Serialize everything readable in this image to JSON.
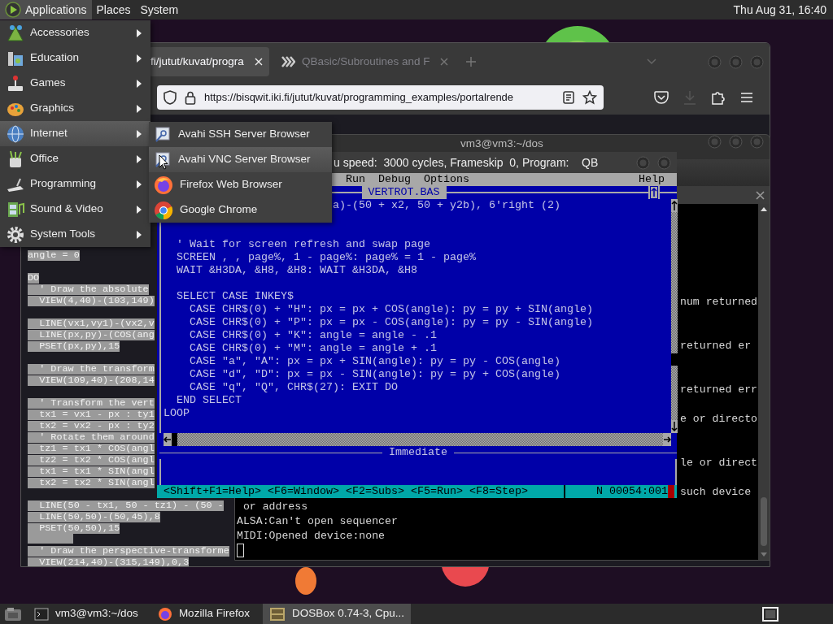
{
  "top_panel": {
    "menus": [
      {
        "label": "Applications",
        "selected": true
      },
      {
        "label": "Places",
        "selected": false
      },
      {
        "label": "System",
        "selected": false
      }
    ],
    "clock": "Thu Aug 31, 16:40"
  },
  "applications_menu": {
    "items": [
      {
        "label": "Accessories",
        "selected": false
      },
      {
        "label": "Education",
        "selected": false
      },
      {
        "label": "Games",
        "selected": false
      },
      {
        "label": "Graphics",
        "selected": false
      },
      {
        "label": "Internet",
        "selected": true
      },
      {
        "label": "Office",
        "selected": false
      },
      {
        "label": "Programming",
        "selected": false
      },
      {
        "label": "Sound & Video",
        "selected": false
      },
      {
        "label": "System Tools",
        "selected": false
      }
    ]
  },
  "internet_submenu": {
    "items": [
      {
        "label": "Avahi SSH Server Browser",
        "selected": false
      },
      {
        "label": "Avahi VNC Server Browser",
        "selected": true
      },
      {
        "label": "Firefox Web Browser",
        "selected": false
      },
      {
        "label": "Google Chrome",
        "selected": false
      }
    ]
  },
  "firefox": {
    "tabs": [
      {
        "title": "fi/jutut/kuvat/progra",
        "selected": true
      },
      {
        "title": "QBasic/Subroutines and F",
        "selected": false
      }
    ],
    "url": "https://bisqwit.iki.fi/jutut/kuvat/programming_examples/portalrende",
    "page_code_lines": [
      {
        "text": "angle = 0"
      },
      {
        "kind": "blank"
      },
      {
        "text": "DO"
      },
      {
        "text": "  ' Draw the absolute"
      },
      {
        "text": "  VIEW(4,40)-(103,149)"
      },
      {
        "kind": "blank"
      },
      {
        "text": "  LINE(vx1,vy1)-(vx2,v"
      },
      {
        "text": "  LINE(px,py)-(COS(ang"
      },
      {
        "text": "  PSET(px,py),15"
      },
      {
        "kind": "blank"
      },
      {
        "text": "  ' Draw the transform"
      },
      {
        "text": "  VIEW(109,40)-(208,14"
      },
      {
        "kind": "blank"
      },
      {
        "text": "  ' Transform the vert"
      },
      {
        "text": "  tx1 = vx1 - px : ty1"
      },
      {
        "text": "  tx2 = vx2 - px : ty2"
      },
      {
        "text": "  ' Rotate them around"
      },
      {
        "text": "  tz1 = tx1 * COS(angl"
      },
      {
        "text": "  tz2 = tx2 * COS(angl"
      },
      {
        "text": "  tx1 = tx1 * SIN(angl"
      },
      {
        "text": "  tx2 = tx2 * SIN(angl"
      },
      {
        "kind": "blank"
      },
      {
        "text": "  LINE(50 - tx1, 50 - tz1) - (50 -"
      },
      {
        "text": "  LINE(50,50)-(50,45),8"
      },
      {
        "text": "  PSET(50,50),15"
      },
      {
        "kind": "selected-blank"
      },
      {
        "text": "  ' Draw the perspective-transforme"
      },
      {
        "text": "  VIEW(214,40)-(315,149),0,3"
      }
    ]
  },
  "terminal": {
    "title": "vm3@vm3:~/dos",
    "lines": [
      {
        "kind": "blank"
      },
      {
        "kind": "blank"
      },
      {
        "kind": "blank"
      },
      {
        "kind": "blank"
      },
      {
        "kind": "blank"
      },
      {
        "kind": "blank"
      },
      {
        "kind": "right",
        "text": "num returned"
      },
      {
        "kind": "blank"
      },
      {
        "kind": "blank"
      },
      {
        "kind": "right",
        "text": "returned er"
      },
      {
        "kind": "blank"
      },
      {
        "kind": "blank"
      },
      {
        "kind": "right",
        "text": "returned err"
      },
      {
        "kind": "blank"
      },
      {
        "kind": "right",
        "text": "e or directo"
      },
      {
        "kind": "blank"
      },
      {
        "kind": "blank"
      },
      {
        "kind": "right",
        "text": "le or direct"
      },
      {
        "kind": "blank"
      },
      {
        "kind": "right",
        "text": "such device"
      },
      {
        "kind": "full",
        "text": " or address"
      },
      {
        "kind": "full",
        "text": "ALSA:Can't open sequencer"
      },
      {
        "kind": "full",
        "text": "MIDI:Opened device:none"
      },
      {
        "kind": "cursor"
      }
    ]
  },
  "dosbox": {
    "title": "u speed:  3000 cycles, Frameskip  0, Program:    QB",
    "qb": {
      "menus": [
        "Run",
        "Debug",
        "Options"
      ],
      "help_menu": "Help",
      "file_title": "VERTROT.BAS",
      "code_lines": [
        {
          "kind": "covered-start",
          "text": "a)-(50 + x2, 50 + y2b), 6'right (2)"
        },
        {
          "kind": "blank"
        },
        {
          "kind": "blank"
        },
        {
          "text": "  ' Wait for screen refresh and swap page"
        },
        {
          "text": "  SCREEN , , page%, 1 - page%: page% = 1 - page%"
        },
        {
          "text": "  WAIT &H3DA, &H8, &H8: WAIT &H3DA, &H8"
        },
        {
          "kind": "blank"
        },
        {
          "text": "  SELECT CASE INKEY$"
        },
        {
          "text": "    CASE CHR$(0) + \"H\": px = px + COS(angle): py = py + SIN(angle)"
        },
        {
          "text": "    CASE CHR$(0) + \"P\": px = px - COS(angle): py = py - SIN(angle)"
        },
        {
          "text": "    CASE CHR$(0) + \"K\": angle = angle - .1"
        },
        {
          "text": "    CASE CHR$(0) + \"M\": angle = angle + .1"
        },
        {
          "text": "    CASE \"a\", \"A\": px = px + SIN(angle): py = py - COS(angle)"
        },
        {
          "text": "    CASE \"d\", \"D\": px = px - SIN(angle): py = py + COS(angle)"
        },
        {
          "text": "    CASE \"q\", \"Q\", CHR$(27): EXIT DO"
        },
        {
          "text": "  END SELECT"
        },
        {
          "text": "LOOP"
        },
        {
          "kind": "blank"
        }
      ],
      "immediate_label": "Immediate",
      "status_keys": "<Shift+F1=Help> <F6=Window> <F2=Subs> <F5=Run> <F8=Step>",
      "cursor_position": "N 00054:001"
    }
  },
  "taskbar": {
    "tasks": [
      {
        "label": "vm3@vm3:~/dos",
        "selected": false
      },
      {
        "label": "Mozilla Firefox",
        "selected": false
      },
      {
        "label": "DOSBox 0.74-3, Cpu...",
        "selected": true
      }
    ]
  }
}
